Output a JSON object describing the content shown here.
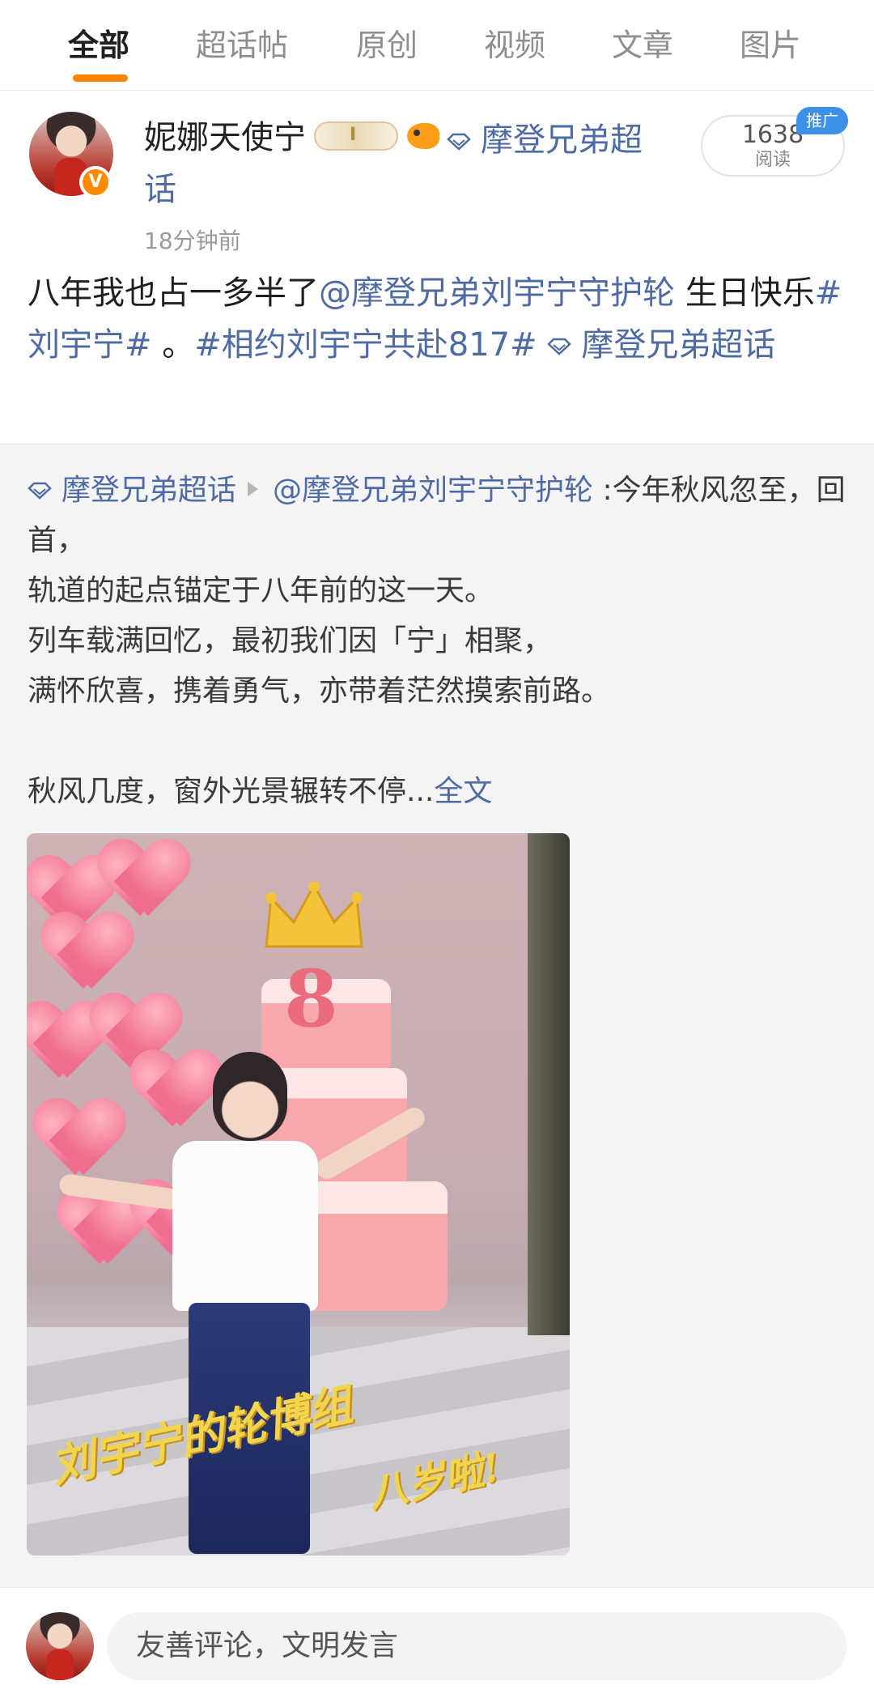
{
  "tabs": [
    {
      "label": "全部",
      "active": true
    },
    {
      "label": "超话帖",
      "active": false
    },
    {
      "label": "原创",
      "active": false
    },
    {
      "label": "视频",
      "active": false
    },
    {
      "label": "文章",
      "active": false
    },
    {
      "label": "图片",
      "active": false
    }
  ],
  "colors": {
    "accent": "#ff8200",
    "link": "#4f6ba3",
    "promo": "#3c91e6"
  },
  "post": {
    "username": "妮娜天使宁",
    "supertopic_line1": "摩登兄弟超",
    "supertopic_line2": "话",
    "time": "18分钟前",
    "read_count": "1638",
    "read_label": "阅读",
    "promo_label": "推广",
    "text_plain_1": "八年我也占一多半了",
    "mention": "@摩登兄弟刘宇宁守护轮",
    "text_plain_2": " 生日快乐",
    "hashtag_1": "#刘宇宁#",
    "text_plain_3": " 。",
    "hashtag_2": "#相约刘宇宁共赴817#",
    "supertopic_tail": "摩登兄弟超话"
  },
  "repost": {
    "supertopic": "摩登兄弟超话",
    "mention": "@摩登兄弟刘宇宁守护轮",
    "lines": [
      " :今年秋风忽至，回首，",
      "轨道的起点锚定于八年前的这一天。",
      "列车载满回忆，最初我们因「宁」相聚，",
      "满怀欣喜，携着勇气，亦带着茫然摸索前路。",
      "",
      "秋风几度，窗外光景辗转不停..."
    ],
    "fulltext_label": "全文",
    "image": {
      "cake_number": "8",
      "caption_1": "刘宇宁的轮博组",
      "caption_2": "八岁啦!"
    }
  },
  "comment": {
    "placeholder": "友善评论，文明发言"
  }
}
